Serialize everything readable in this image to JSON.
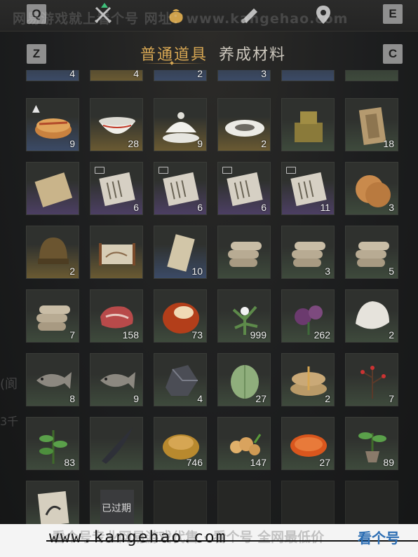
{
  "keys": {
    "q": "Q",
    "e": "E",
    "z": "Z",
    "c": "C"
  },
  "top_icons": [
    "crossed-swords-icon",
    "bag-icon",
    "scroll-icon",
    "map-pin-icon"
  ],
  "watermark_top": "网易游戏就上看个号  网址：www.kangehao.com",
  "tabs": {
    "general": "普通道具",
    "materials": "养成材料"
  },
  "rows": [
    [
      {
        "q": "4",
        "r": "r-blue"
      },
      {
        "q": "4",
        "r": "r-gold"
      },
      {
        "q": "2",
        "r": "r-blue"
      },
      {
        "q": "3",
        "r": "r-blue"
      },
      {
        "q": "",
        "r": "r-blue"
      },
      {
        "q": "",
        "r": "r-green"
      }
    ],
    [
      {
        "q": "9",
        "r": "r-blue",
        "icon": "pastry-icon",
        "badge": "up"
      },
      {
        "q": "28",
        "r": "r-gold",
        "icon": "porcelain-bowl-icon"
      },
      {
        "q": "9",
        "r": "r-gold",
        "icon": "lidded-bowl-icon"
      },
      {
        "q": "2",
        "r": "r-gold",
        "icon": "porcelain-plate-icon"
      },
      {
        "q": "",
        "r": "r-green",
        "icon": "bronze-seal-icon"
      },
      {
        "q": "18",
        "r": "r-green",
        "icon": "wooden-plaque-icon"
      }
    ],
    [
      {
        "q": "",
        "r": "r-purple",
        "icon": "old-map-icon"
      },
      {
        "q": "6",
        "r": "r-purple",
        "icon": "manuscript-icon",
        "badge": "new"
      },
      {
        "q": "6",
        "r": "r-purple",
        "icon": "manuscript-icon",
        "badge": "new"
      },
      {
        "q": "6",
        "r": "r-purple",
        "icon": "manuscript-icon",
        "badge": "new"
      },
      {
        "q": "11",
        "r": "r-purple",
        "icon": "manuscript-icon",
        "badge": "new"
      },
      {
        "q": "3",
        "r": "r-green",
        "icon": "flatbread-icon"
      }
    ],
    [
      {
        "q": "2",
        "r": "r-gold",
        "icon": "helmet-icon"
      },
      {
        "q": "",
        "r": "r-gold",
        "icon": "scroll-painting-icon"
      },
      {
        "q": "10",
        "r": "r-blue",
        "icon": "paper-scroll-icon"
      },
      {
        "q": "",
        "r": "r-green",
        "icon": "logs-icon"
      },
      {
        "q": "3",
        "r": "r-green",
        "icon": "logs-icon"
      },
      {
        "q": "5",
        "r": "r-green",
        "icon": "logs-icon"
      }
    ],
    [
      {
        "q": "7",
        "r": "r-green",
        "icon": "logs-icon"
      },
      {
        "q": "158",
        "r": "r-green",
        "icon": "raw-meat-icon"
      },
      {
        "q": "73",
        "r": "r-green",
        "icon": "red-stone-icon"
      },
      {
        "q": "999",
        "r": "r-green",
        "icon": "herb-icon"
      },
      {
        "q": "262",
        "r": "r-green",
        "icon": "purple-flower-icon"
      },
      {
        "q": "2",
        "r": "r-green",
        "icon": "fur-pelt-icon"
      }
    ],
    [
      {
        "q": "8",
        "r": "r-green",
        "icon": "fish-icon"
      },
      {
        "q": "9",
        "r": "r-green",
        "icon": "fish-icon"
      },
      {
        "q": "4",
        "r": "r-green",
        "icon": "ore-icon"
      },
      {
        "q": "27",
        "r": "r-green",
        "icon": "melon-icon"
      },
      {
        "q": "2",
        "r": "r-green",
        "icon": "rice-sacks-icon"
      },
      {
        "q": "7",
        "r": "r-green",
        "icon": "red-berry-branch-icon"
      }
    ],
    [
      {
        "q": "83",
        "r": "r-green",
        "icon": "green-plant-icon"
      },
      {
        "q": "",
        "r": "r-green",
        "icon": "black-feather-icon"
      },
      {
        "q": "746",
        "r": "r-green",
        "icon": "gold-ingot-icon"
      },
      {
        "q": "147",
        "r": "r-green",
        "icon": "ginger-root-icon"
      },
      {
        "q": "27",
        "r": "r-green",
        "icon": "orange-slice-icon"
      },
      {
        "q": "89",
        "r": "r-green",
        "icon": "potted-sapling-icon"
      }
    ],
    [
      {
        "q": "",
        "r": "r-green",
        "icon": "ink-painting-icon"
      },
      {
        "q": "",
        "r": "r-green",
        "icon": "expired-item-icon",
        "text": "已过期"
      },
      {
        "q": "",
        "r": "r-empty"
      },
      {
        "q": "",
        "r": "r-empty"
      },
      {
        "q": "",
        "r": "r-empty"
      },
      {
        "q": "",
        "r": "r-empty"
      }
    ]
  ],
  "footer": {
    "url": "www.kangehao.com",
    "ghost": "看个号专业网易游戏代售 · 看个号 全网最低价",
    "logo": "看个号"
  },
  "colors": {
    "accent": "#d6a653",
    "panel": "#2f312e"
  }
}
